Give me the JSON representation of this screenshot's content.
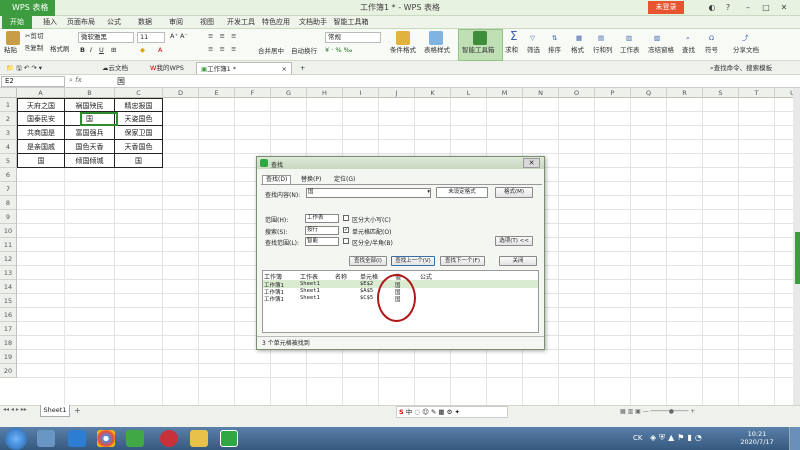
{
  "window": {
    "app_name": "WPS 表格",
    "title": "工作簿1 * - WPS 表格",
    "login": "未登录"
  },
  "menu": [
    "开始",
    "插入",
    "页面布局",
    "公式",
    "数据",
    "审阅",
    "视图",
    "开发工具",
    "特色应用",
    "文档助手",
    "智能工具箱"
  ],
  "ribbon": {
    "paste": "粘贴",
    "cut": "剪切",
    "copy": "复制",
    "format_painter": "格式刷",
    "font_name": "微软雅黑",
    "font_size": "11",
    "number_format": "常规",
    "merge_center": "合并居中",
    "wrap_text": "自动换行",
    "cond_format": "条件格式",
    "table_style": "表格样式",
    "smart_tools": "智能工具箱",
    "sum": "求和",
    "filter": "筛选",
    "sort": "排序",
    "format": "格式",
    "row_col": "行和列",
    "worksheet": "工作表",
    "freeze": "冻结窗格",
    "find": "查找",
    "symbol": "符号",
    "share": "分享文档"
  },
  "doc_tabs": [
    "云文档",
    "我的WPS",
    "工作簿1 *"
  ],
  "tab_search": "查找命令、搜索模板",
  "formula_bar": {
    "name_box": "E2",
    "fx": "fx",
    "content": "国"
  },
  "columns": [
    "A",
    "B",
    "C",
    "D",
    "E",
    "F",
    "G",
    "H",
    "I",
    "J",
    "K",
    "L",
    "M",
    "N",
    "O",
    "P",
    "Q",
    "R",
    "S",
    "T",
    "U"
  ],
  "rows": [
    "1",
    "2",
    "3",
    "4",
    "5",
    "6",
    "7",
    "8",
    "9",
    "10",
    "11",
    "12",
    "13",
    "14",
    "15",
    "16",
    "17",
    "18",
    "19",
    "20"
  ],
  "cells": [
    [
      "天府之国",
      "祸国殃民",
      "精忠报国"
    ],
    [
      "国泰民安",
      "国",
      "天姿国色"
    ],
    [
      "共商国是",
      "富国强兵",
      "保家卫国"
    ],
    [
      "是亲国戚",
      "国色天香",
      "天香国色"
    ],
    [
      "国",
      "倾国倾城",
      "国"
    ]
  ],
  "sheet_tab": "Sheet1",
  "dialog": {
    "title": "查找",
    "tabs": [
      "查找(D)",
      "替换(P)",
      "定位(G)"
    ],
    "find_label": "查找内容(N):",
    "find_value": "国",
    "format_status": "未设定格式",
    "format_btn": "格式(M)",
    "scope_label": "范围(H):",
    "scope_value": "工作表",
    "search_label": "搜索(S):",
    "search_value": "按行",
    "lookin_label": "查找范围(L):",
    "lookin_value": "智能",
    "match_case": "区分大小写(C)",
    "match_cell": "单元格匹配(O)",
    "match_width": "区分全/半角(B)",
    "options_btn": "选项(T) <<",
    "find_all": "查找全部(I)",
    "find_prev": "查找上一个(V)",
    "find_next": "查找下一个(F)",
    "close": "关闭",
    "result_headers": [
      "工作簿",
      "工作表",
      "名称",
      "单元格",
      "值",
      "公式"
    ],
    "results": [
      [
        "工作簿1",
        "Sheet1",
        "",
        "$E$2",
        "国",
        ""
      ],
      [
        "工作簿1",
        "Sheet1",
        "",
        "$A$5",
        "国",
        ""
      ],
      [
        "工作簿1",
        "Sheet1",
        "",
        "$C$5",
        "国",
        ""
      ]
    ],
    "status": "3 个单元格被找到"
  },
  "clock": {
    "time": "10:21",
    "date": "2020/7/17"
  },
  "ime_label": "中",
  "tray_text": "CK"
}
